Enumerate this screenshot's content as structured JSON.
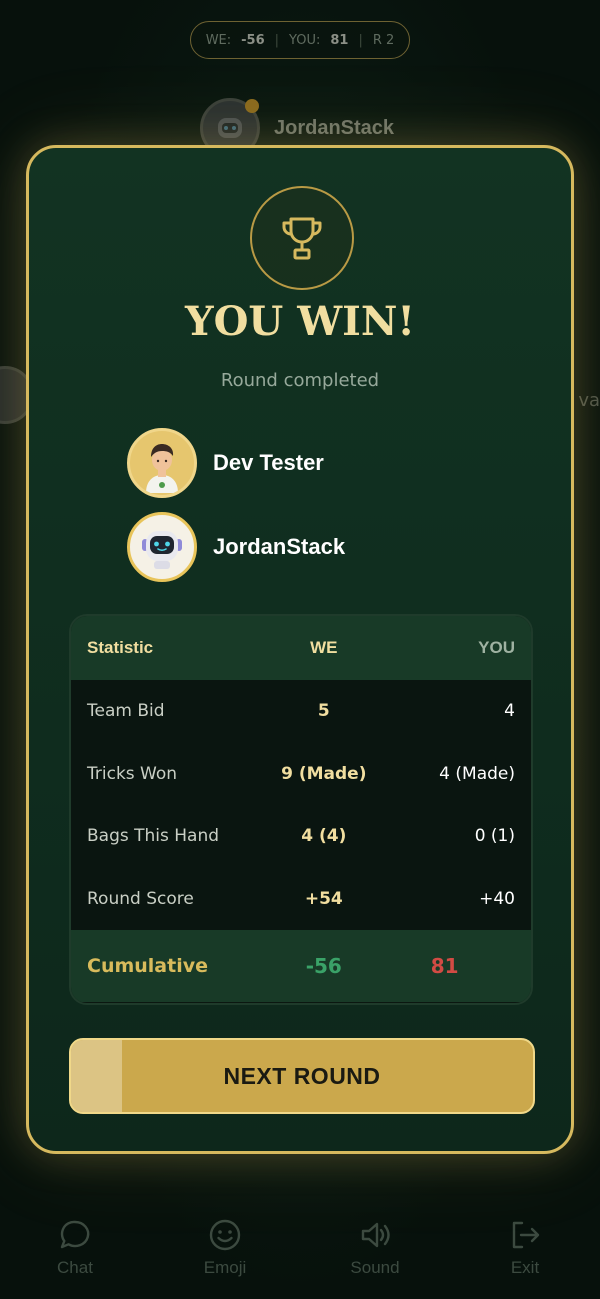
{
  "scoreboard": {
    "we_label": "WE:",
    "we_value": "-56",
    "you_label": "YOU:",
    "you_value": "81",
    "round_label": "R 2"
  },
  "background": {
    "top_player_name": "JordanStack",
    "right_player_name_fragment": "va"
  },
  "modal": {
    "icon": "trophy-icon",
    "title": "YOU WIN!",
    "subtitle": "Round completed",
    "players": [
      {
        "name": "Dev Tester",
        "avatar": "person-avatar"
      },
      {
        "name": "JordanStack",
        "avatar": "robot-avatar"
      }
    ],
    "stats": {
      "headers": [
        "Statistic",
        "WE",
        "YOU"
      ],
      "rows": [
        {
          "label": "Team Bid",
          "we": "5",
          "you": "4"
        },
        {
          "label": "Tricks Won",
          "we": "9 (Made)",
          "you": "4 (Made)"
        },
        {
          "label": "Bags This Hand",
          "we": "4 (4)",
          "you": "0 (1)"
        },
        {
          "label": "Round Score",
          "we": "+54",
          "you": "+40"
        }
      ],
      "cumulative": {
        "label": "Cumulative",
        "we": "-56",
        "you": "81"
      }
    },
    "next_button": {
      "label": "NEXT ROUND",
      "progress": 0.11
    }
  },
  "bottom_nav": [
    {
      "label": "Chat",
      "icon": "chat-icon"
    },
    {
      "label": "Emoji",
      "icon": "smile-icon"
    },
    {
      "label": "Sound",
      "icon": "speaker-icon"
    },
    {
      "label": "Exit",
      "icon": "exit-icon"
    }
  ],
  "colors": {
    "accent_gold": "#d6b95e",
    "we_positive": "#3aa268",
    "you_negative": "#d24b44",
    "modal_bg": "#123322"
  }
}
